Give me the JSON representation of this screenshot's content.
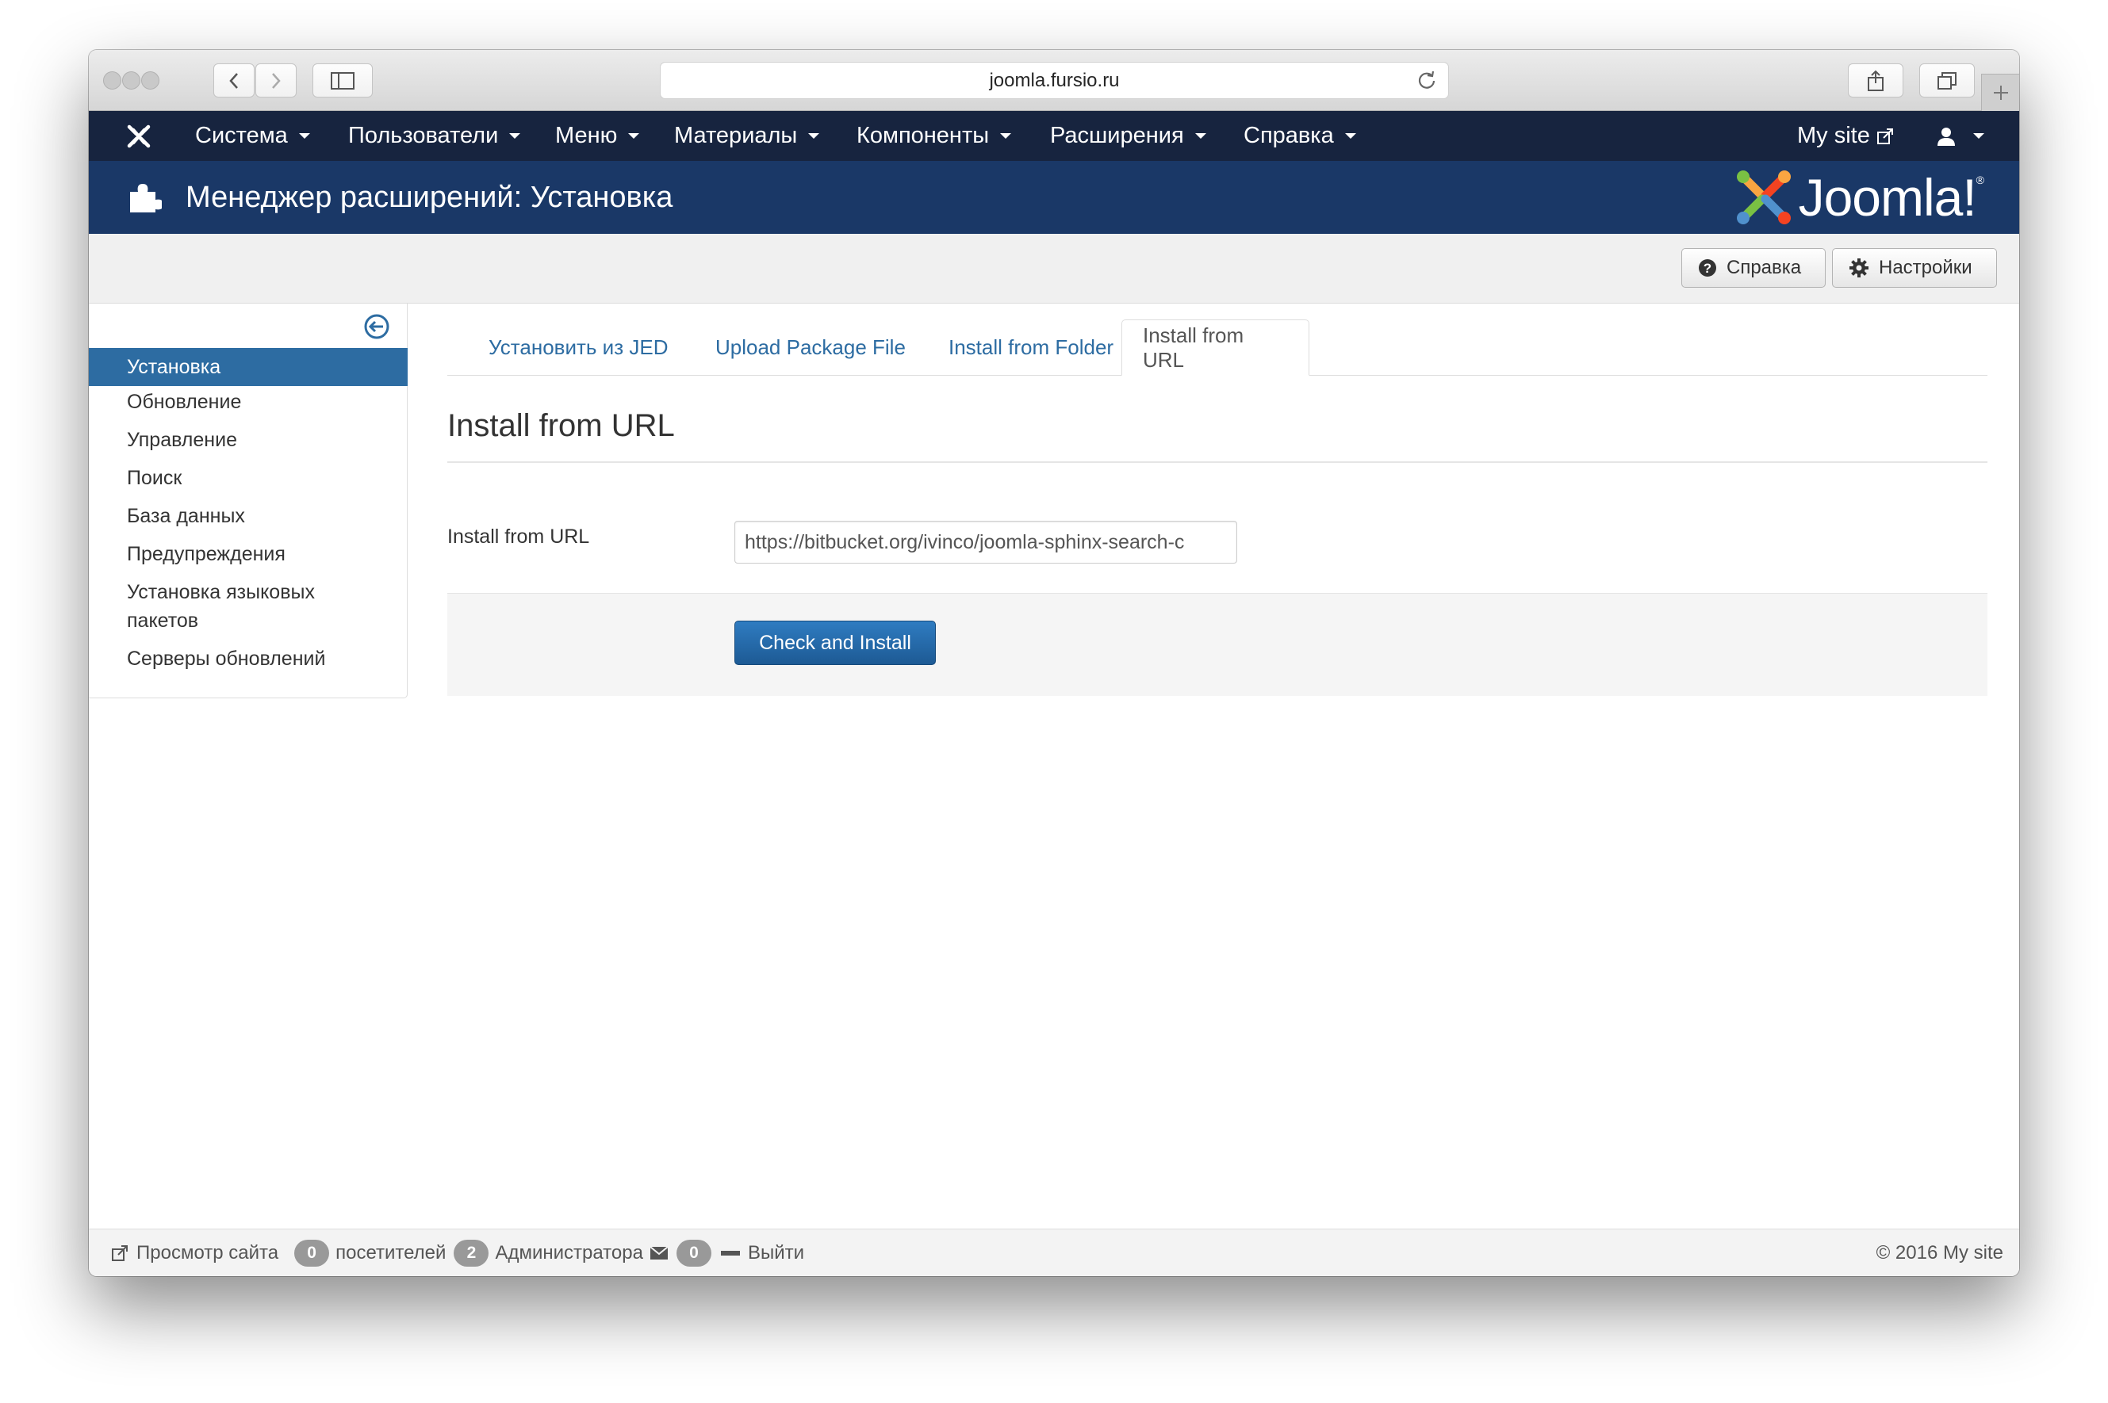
{
  "browser": {
    "address": "joomla.fursio.ru"
  },
  "navbar": {
    "menus": [
      {
        "label": "Система"
      },
      {
        "label": "Пользователи"
      },
      {
        "label": "Меню"
      },
      {
        "label": "Материалы"
      },
      {
        "label": "Компоненты"
      },
      {
        "label": "Расширения"
      },
      {
        "label": "Справка"
      }
    ],
    "site_link": "My site"
  },
  "header": {
    "title": "Менеджер расширений: Установка",
    "brand": "Joomla!",
    "brand_reg": "®"
  },
  "toolbar": {
    "help_label": "Справка",
    "options_label": "Настройки"
  },
  "sidebar": {
    "items": [
      {
        "label": "Установка",
        "active": true
      },
      {
        "label": "Обновление"
      },
      {
        "label": "Управление"
      },
      {
        "label": "Поиск"
      },
      {
        "label": "База данных"
      },
      {
        "label": "Предупреждения"
      },
      {
        "label_line1": "Установка языковых",
        "label_line2": "пакетов"
      },
      {
        "label": "Серверы обновлений"
      }
    ]
  },
  "tabs": [
    {
      "label": "Установить из JED"
    },
    {
      "label": "Upload Package File"
    },
    {
      "label": "Install from Folder"
    },
    {
      "label": "Install from URL",
      "active": true
    }
  ],
  "main": {
    "section_title": "Install from URL",
    "field_label": "Install from URL",
    "field_value": "https://bitbucket.org/ivinco/joomla-sphinx-search-c",
    "submit_label": "Check and Install"
  },
  "statusbar": {
    "view_site": "Просмотр сайта",
    "visitors_count": "0",
    "visitors_label": "посетителей",
    "admins_count": "2",
    "admins_label": "Администратора",
    "messages_count": "0",
    "logout": "Выйти",
    "copyright": "© 2016 My site"
  },
  "colors": {
    "navbar": "#17243f",
    "header": "#1a3867",
    "accent": "#2d6ca2"
  }
}
